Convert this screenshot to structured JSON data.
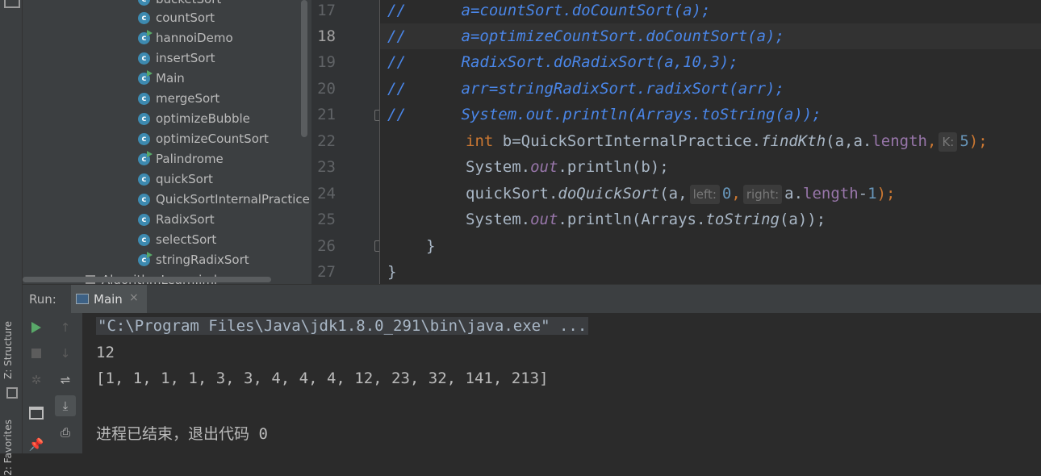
{
  "sidebar": {
    "structure_label": "Z: Structure",
    "favorites_label": "2: Favorites"
  },
  "project_tree": {
    "items": [
      {
        "label": "bucketSort",
        "runnable": false
      },
      {
        "label": "countSort",
        "runnable": false
      },
      {
        "label": "hannoiDemo",
        "runnable": true
      },
      {
        "label": "insertSort",
        "runnable": false
      },
      {
        "label": "Main",
        "runnable": true
      },
      {
        "label": "mergeSort",
        "runnable": false
      },
      {
        "label": "optimizeBubble",
        "runnable": false
      },
      {
        "label": "optimizeCountSort",
        "runnable": false
      },
      {
        "label": "Palindrome",
        "runnable": true
      },
      {
        "label": "quickSort",
        "runnable": false
      },
      {
        "label": "QuickSortInternalPractice",
        "runnable": false
      },
      {
        "label": "RadixSort",
        "runnable": false
      },
      {
        "label": "selectSort",
        "runnable": false
      },
      {
        "label": "stringRadixSort",
        "runnable": true
      }
    ],
    "iml_file": "AlgorithmLearn.iml"
  },
  "editor": {
    "current_line": "18",
    "lines": [
      {
        "n": "17",
        "comment": "//",
        "code": "a=countSort.doCountSort(a);"
      },
      {
        "n": "18",
        "comment": "//",
        "code": "a=optimizeCountSort.doCountSort(a);"
      },
      {
        "n": "19",
        "comment": "//",
        "code": "RadixSort.doRadixSort(a,10,3);"
      },
      {
        "n": "20",
        "comment": "//",
        "code": "arr=stringRadixSort.radixSort(arr);"
      },
      {
        "n": "21",
        "comment": "//",
        "code": "System.out.println(Arrays.toString(a));"
      },
      {
        "n": "22"
      },
      {
        "n": "23"
      },
      {
        "n": "24"
      },
      {
        "n": "25"
      },
      {
        "n": "26"
      },
      {
        "n": "27"
      }
    ],
    "line22": {
      "kw": "int",
      "pre": " b=QuickSortInternalPractice.",
      "method": "findKth",
      "open": "(a,a.",
      "field": "length",
      "comma": ",",
      "hint": "K:",
      "num": "5",
      "close": ");"
    },
    "line23": {
      "pre": "System.",
      "field": "out",
      "post": ".println(b);"
    },
    "line24": {
      "pre": "quickSort.",
      "method": "doQuickSort",
      "open": "(a,",
      "hint1": "left:",
      "num1": "0",
      "comma": ",",
      "hint2": "right:",
      "mid": "a.",
      "field": "length",
      "minus": "-",
      "num2": "1",
      "close": ");"
    },
    "line25": {
      "pre": "System.",
      "field": "out",
      "mid": ".println(Arrays.",
      "method": "toString",
      "post": "(a));"
    },
    "line26": {
      "code": "}"
    },
    "line27": {
      "code": "}"
    }
  },
  "run_panel": {
    "label": "Run:",
    "tab_label": "Main",
    "tab_close": "×",
    "console_lines": [
      "\"C:\\Program Files\\Java\\jdk1.8.0_291\\bin\\java.exe\" ...",
      "12",
      "[1, 1, 1, 1, 3, 3, 4, 4, 4, 12, 23, 32, 141, 213]",
      "",
      "进程已结束，退出代码 0"
    ]
  },
  "colors": {
    "background": "#2b2b2b",
    "panel": "#3c3f41",
    "comment_blue": "#4a86e8",
    "keyword": "#cc7832",
    "field": "#9876aa",
    "number": "#6897bb",
    "run_green": "#59a869"
  }
}
